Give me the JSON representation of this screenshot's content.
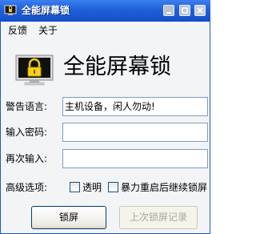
{
  "window": {
    "title": "全能屏幕锁",
    "icon": "monitor-lock-icon"
  },
  "titlebar_buttons": [
    "minimize-icon",
    "maximize-icon",
    "close-icon"
  ],
  "menu": {
    "items": [
      {
        "label": "反馈"
      },
      {
        "label": "关于"
      }
    ]
  },
  "header": {
    "logo_icon": "monitor-padlock-icon",
    "heading": "全能屏幕锁"
  },
  "form": {
    "warning_label": "警告语言:",
    "warning_value": "主机设备，闲人勿动!",
    "password_label": "输入密码:",
    "password_value": "",
    "confirm_label": "再次输入:",
    "confirm_value": ""
  },
  "options": {
    "label": "高级选项:",
    "transparent_label": "透明",
    "transparent_checked": false,
    "restart_label": "暴力重启后继续锁屏",
    "restart_checked": false
  },
  "buttons": {
    "lock": "锁屏",
    "last_record": "上次锁屏记录",
    "last_record_enabled": false
  },
  "colors": {
    "titlebar": "#1f5fd8",
    "window_bg": "#f3f4f6",
    "input_border": "#7f9db9",
    "button_border": "#003c74",
    "disabled_text": "#a7a69a"
  }
}
